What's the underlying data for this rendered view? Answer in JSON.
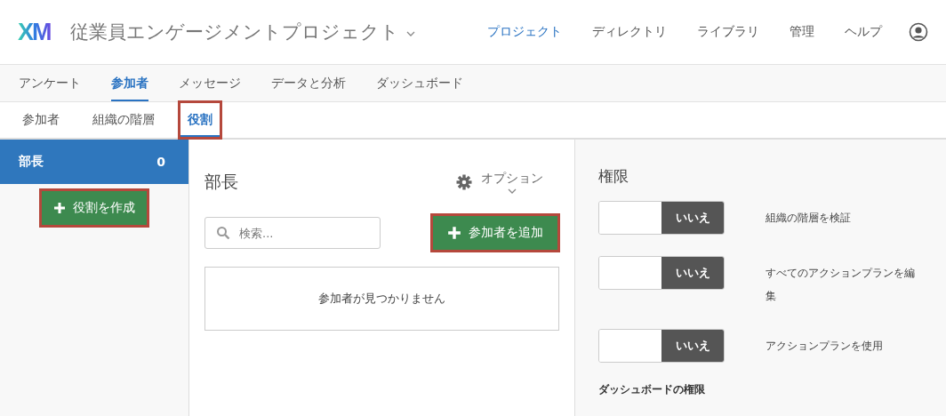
{
  "header": {
    "logo": "XM",
    "project_title": "従業員エンゲージメントプロジェクト",
    "nav": [
      {
        "label": "プロジェクト",
        "selected": true
      },
      {
        "label": "ディレクトリ",
        "selected": false
      },
      {
        "label": "ライブラリ",
        "selected": false
      },
      {
        "label": "管理",
        "selected": false
      },
      {
        "label": "ヘルプ",
        "selected": false
      }
    ]
  },
  "tabs": [
    {
      "label": "アンケート",
      "selected": false
    },
    {
      "label": "参加者",
      "selected": true
    },
    {
      "label": "メッセージ",
      "selected": false
    },
    {
      "label": "データと分析",
      "selected": false
    },
    {
      "label": "ダッシュボード",
      "selected": false
    }
  ],
  "subtabs": [
    {
      "label": "参加者",
      "selected": false,
      "highlighted": false
    },
    {
      "label": "組織の階層",
      "selected": false,
      "highlighted": false
    },
    {
      "label": "役割",
      "selected": true,
      "highlighted": true
    }
  ],
  "sidebar": {
    "roles": [
      {
        "name": "部長",
        "count": "0",
        "selected": true
      }
    ],
    "create_button": {
      "label": "役割を作成",
      "highlighted": true
    }
  },
  "role_panel": {
    "title": "部長",
    "options_label": "オプション",
    "search": {
      "placeholder": "検索..."
    },
    "add_button": {
      "label": "参加者を追加",
      "highlighted": true
    },
    "empty_message": "参加者が見つかりません"
  },
  "permissions": {
    "title": "権限",
    "items": [
      {
        "toggle_label": "いいえ",
        "on": false,
        "label": "組織の階層を検証"
      },
      {
        "toggle_label": "いいえ",
        "on": false,
        "label": "すべてのアクションプランを編集"
      },
      {
        "toggle_label": "いいえ",
        "on": false,
        "label": "アクションプランを使用"
      }
    ],
    "subheading": "ダッシュボードの権限"
  }
}
